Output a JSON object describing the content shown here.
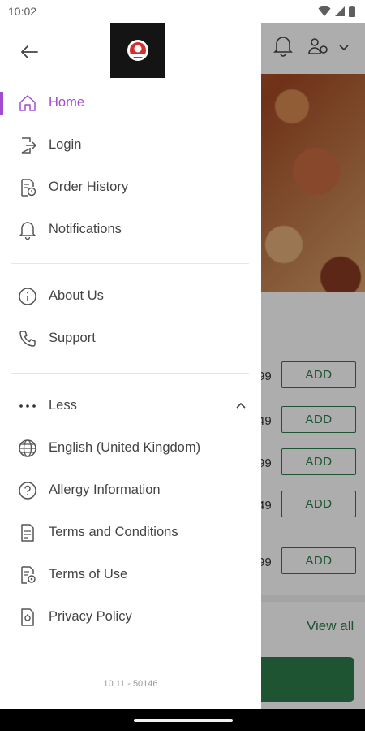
{
  "status_bar": {
    "time": "10:02"
  },
  "background": {
    "products": [
      {
        "price": "99",
        "add_label": "ADD"
      },
      {
        "price": "49",
        "add_label": "ADD"
      },
      {
        "price": "99",
        "add_label": "ADD"
      },
      {
        "price": "49",
        "add_label": "ADD"
      },
      {
        "price": "99",
        "add_label": "ADD"
      }
    ],
    "view_all": "View all"
  },
  "drawer": {
    "items": [
      {
        "label": "Home",
        "icon": "home-icon",
        "active": true
      },
      {
        "label": "Login",
        "icon": "login-icon"
      },
      {
        "label": "Order History",
        "icon": "order-history-icon"
      },
      {
        "label": "Notifications",
        "icon": "bell-icon"
      },
      {
        "label": "About Us",
        "icon": "info-icon"
      },
      {
        "label": "Support",
        "icon": "phone-icon"
      },
      {
        "label": "Less",
        "icon": "more-dots-icon"
      },
      {
        "label": "English (United Kingdom)",
        "icon": "globe-icon"
      },
      {
        "label": "Allergy Information",
        "icon": "question-icon"
      },
      {
        "label": "Terms and Conditions",
        "icon": "document-icon"
      },
      {
        "label": "Terms of Use",
        "icon": "document-settings-icon"
      },
      {
        "label": "Privacy Policy",
        "icon": "privacy-icon"
      }
    ],
    "version": "10.11 - 50146"
  },
  "colors": {
    "accent": "#a24bd0",
    "brand_green": "#2e7d4a"
  }
}
